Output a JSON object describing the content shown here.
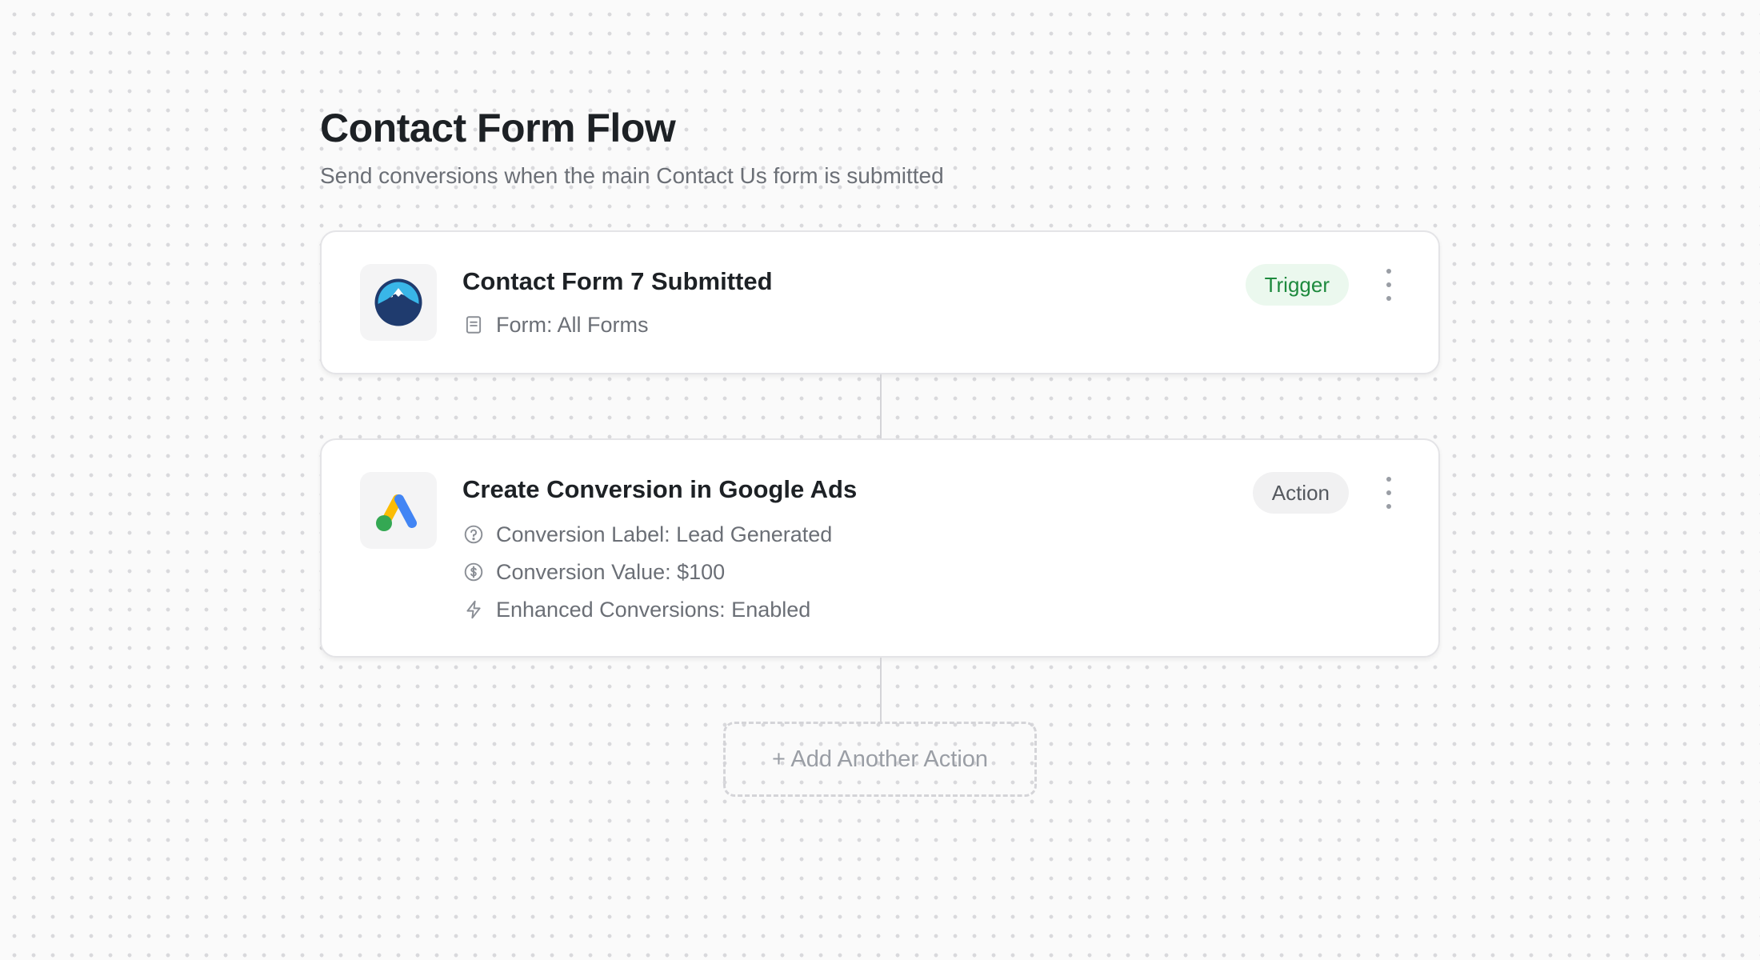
{
  "page": {
    "title": "Contact Form Flow",
    "subtitle": "Send conversions when the main Contact Us form is submitted"
  },
  "trigger_step": {
    "app_icon": "contact-form-7-mountain-icon",
    "title": "Contact Form 7 Submitted",
    "badge": "Trigger",
    "details": [
      {
        "icon": "document-icon",
        "text": "Form: All Forms"
      }
    ]
  },
  "action_step": {
    "app_icon": "google-ads-icon",
    "title": "Create Conversion in Google Ads",
    "badge": "Action",
    "details": [
      {
        "icon": "question-circle-icon",
        "text": "Conversion Label: Lead Generated"
      },
      {
        "icon": "dollar-circle-icon",
        "text": "Conversion Value: $100"
      },
      {
        "icon": "lightning-icon",
        "text": "Enhanced Conversions: Enabled"
      }
    ]
  },
  "add_action": {
    "label": "+ Add Another Action"
  },
  "colors": {
    "background": "#fafafa",
    "trigger_badge_bg": "#ebf8ee",
    "trigger_badge_text": "#1e8a3e",
    "action_badge_bg": "#f1f1f2",
    "google_blue": "#4285F4",
    "google_yellow": "#FBBC04",
    "google_green": "#34A853",
    "cf7_navy": "#1f3b6e",
    "cf7_sky": "#39b6e8"
  }
}
